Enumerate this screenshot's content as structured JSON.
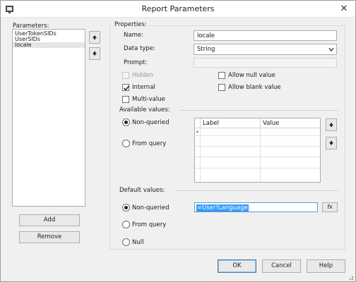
{
  "window": {
    "title": "Report Parameters",
    "close_glyph": "✕"
  },
  "left": {
    "parameters_label": "Parameters:",
    "items": [
      "UserTokenSIDs",
      "UserSIDs",
      "locale"
    ],
    "selected_index": 2,
    "add_label": "Add",
    "remove_label": "Remove"
  },
  "properties": {
    "section_label": "Properties:",
    "name_label": "Name:",
    "name_value": "locale",
    "datatype_label": "Data type:",
    "datatype_value": "String",
    "prompt_label": "Prompt:",
    "prompt_value": "",
    "hidden_label": "Hidden",
    "internal_label": "Internal",
    "multivalue_label": "Multi-value",
    "allow_null_label": "Allow null value",
    "allow_blank_label": "Allow blank value",
    "hidden_checked": false,
    "internal_checked": true,
    "multivalue_checked": false,
    "allow_null_checked": false,
    "allow_blank_checked": false
  },
  "available": {
    "section_label": "Available values:",
    "nonqueried_label": "Non-queried",
    "fromquery_label": "From query",
    "selected": "Non-queried",
    "grid_headers": [
      "Label",
      "Value"
    ],
    "new_row_marker": "*"
  },
  "defaults": {
    "section_label": "Default values:",
    "nonqueried_label": "Non-queried",
    "fromquery_label": "From query",
    "null_label": "Null",
    "selected": "Non-queried",
    "expression_value": "=User!Language",
    "fx_label": "fx"
  },
  "footer": {
    "ok_label": "OK",
    "cancel_label": "Cancel",
    "help_label": "Help"
  },
  "icons": {
    "move_up": "up-arrow-icon",
    "move_down": "down-arrow-icon",
    "expression": "fx-icon"
  }
}
